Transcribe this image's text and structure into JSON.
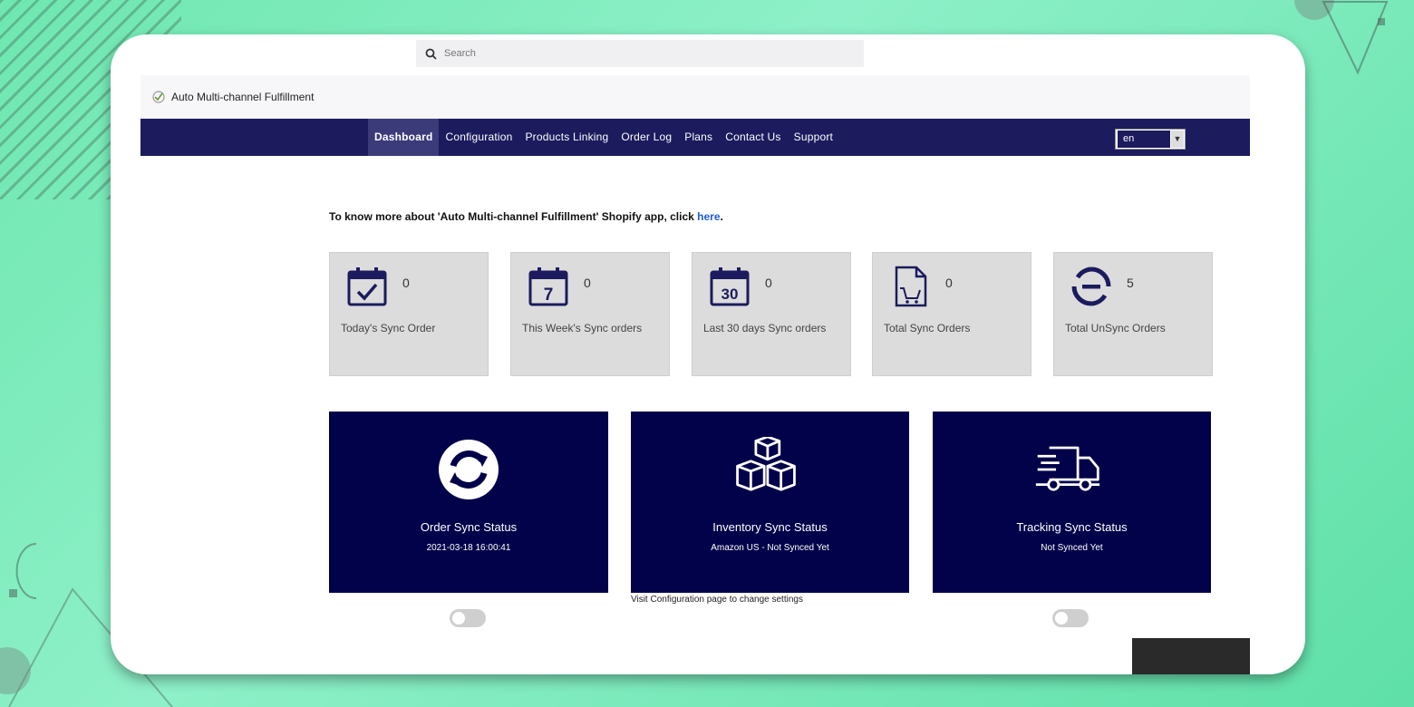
{
  "search": {
    "placeholder": "Search"
  },
  "header": {
    "app_title": "Auto Multi-channel Fulfillment"
  },
  "nav": {
    "items": [
      {
        "label": "Dashboard",
        "active": true
      },
      {
        "label": "Configuration"
      },
      {
        "label": "Products Linking"
      },
      {
        "label": "Order Log"
      },
      {
        "label": "Plans"
      },
      {
        "label": "Contact Us"
      },
      {
        "label": "Support"
      }
    ],
    "language": "en"
  },
  "info": {
    "prefix": "To know more about 'Auto Multi-channel Fulfillment' Shopify app, click ",
    "link_text": "here",
    "suffix": "."
  },
  "stats": [
    {
      "count": "0",
      "label": "Today's Sync Order",
      "icon": "calendar-check-icon"
    },
    {
      "count": "0",
      "label": "This Week's Sync orders",
      "icon": "calendar-7-icon",
      "day": "7"
    },
    {
      "count": "0",
      "label": "Last 30 days Sync orders",
      "icon": "calendar-30-icon",
      "day": "30"
    },
    {
      "count": "0",
      "label": "Total Sync Orders",
      "icon": "document-cart-icon"
    },
    {
      "count": "5",
      "label": "Total UnSync Orders",
      "icon": "unsync-icon"
    }
  ],
  "tiles": [
    {
      "title": "Order Sync Status",
      "subtitle": "2021-03-18 16:00:41",
      "icon": "sync-arrows-icon"
    },
    {
      "title": "Inventory Sync Status",
      "subtitle": "Amazon US - Not Synced Yet",
      "icon": "boxes-icon"
    },
    {
      "title": "Tracking Sync Status",
      "subtitle": "Not Synced Yet",
      "icon": "delivery-truck-icon"
    }
  ],
  "hint": "Visit Configuration page to change settings",
  "colors": {
    "navbar": "#1b1b5e",
    "tile": "#02024a",
    "link": "#1e5bd0",
    "card": "#dcdcdc"
  }
}
